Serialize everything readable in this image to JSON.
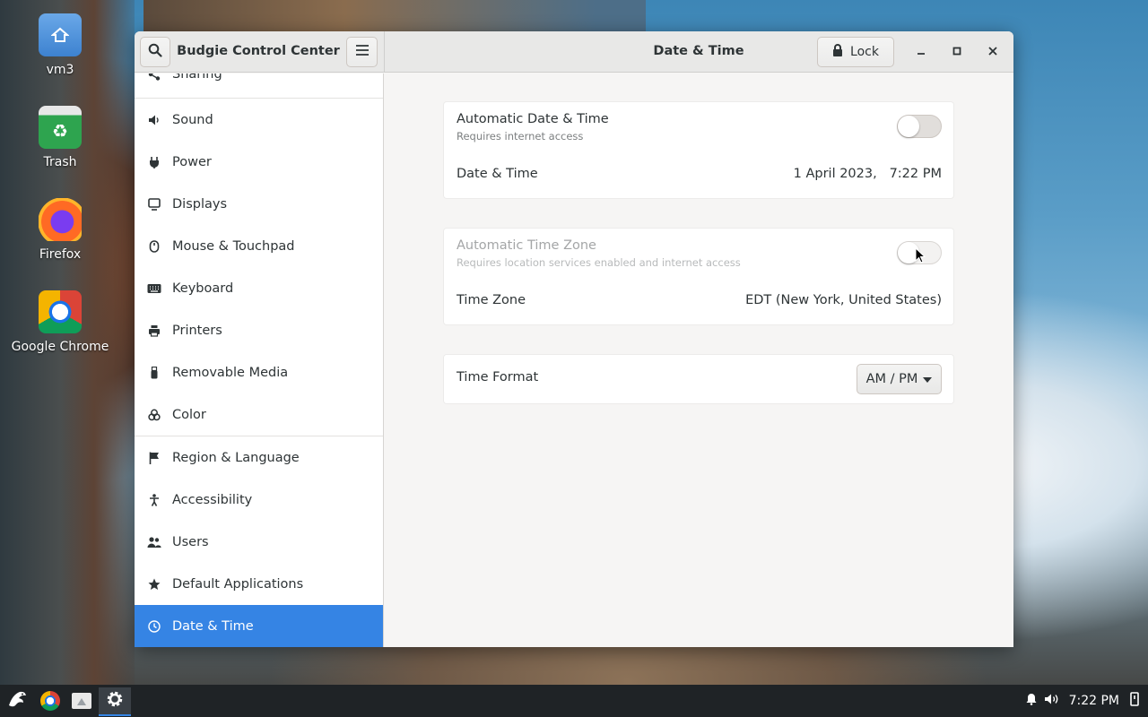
{
  "desktop": {
    "icons": [
      {
        "label": "vm3",
        "icon": "home-folder-icon"
      },
      {
        "label": "Trash",
        "icon": "trash-icon"
      },
      {
        "label": "Firefox",
        "icon": "firefox-icon"
      },
      {
        "label": "Google Chrome",
        "icon": "chrome-icon"
      }
    ]
  },
  "window": {
    "sidebar_title": "Budgie Control Center",
    "page_title": "Date & Time",
    "lock_label": "Lock"
  },
  "sidebar": {
    "items": [
      {
        "label": "Sharing",
        "icon": "share-icon"
      },
      {
        "label": "Sound",
        "icon": "speaker-icon"
      },
      {
        "label": "Power",
        "icon": "power-icon"
      },
      {
        "label": "Displays",
        "icon": "display-icon"
      },
      {
        "label": "Mouse & Touchpad",
        "icon": "mouse-icon"
      },
      {
        "label": "Keyboard",
        "icon": "keyboard-icon"
      },
      {
        "label": "Printers",
        "icon": "printer-icon"
      },
      {
        "label": "Removable Media",
        "icon": "usb-icon"
      },
      {
        "label": "Color",
        "icon": "color-icon"
      },
      {
        "label": "Region & Language",
        "icon": "flag-icon"
      },
      {
        "label": "Accessibility",
        "icon": "accessibility-icon"
      },
      {
        "label": "Users",
        "icon": "users-icon"
      },
      {
        "label": "Default Applications",
        "icon": "star-icon"
      },
      {
        "label": "Date & Time",
        "icon": "clock-icon"
      }
    ],
    "active": "Date & Time"
  },
  "content": {
    "auto_datetime": {
      "title": "Automatic Date & Time",
      "subtitle": "Requires internet access",
      "enabled": false
    },
    "datetime": {
      "title": "Date & Time",
      "date": "1 April 2023,",
      "time": "7:22 PM"
    },
    "auto_timezone": {
      "title": "Automatic Time Zone",
      "subtitle": "Requires location services enabled and internet access",
      "enabled": false,
      "sensitive": false
    },
    "timezone": {
      "title": "Time Zone",
      "value": "EDT (New York, United States)"
    },
    "time_format": {
      "title": "Time Format",
      "value": "AM / PM"
    }
  },
  "taskbar": {
    "clock": "7:22 PM",
    "tray_icons": [
      "bell-icon",
      "volume-icon",
      "power-menu-icon"
    ],
    "apps": [
      "budgie-menu-icon",
      "chrome-icon",
      "files-icon",
      "settings-icon"
    ]
  },
  "colors": {
    "accent": "#3584e4",
    "taskbar": "#1f2326"
  }
}
